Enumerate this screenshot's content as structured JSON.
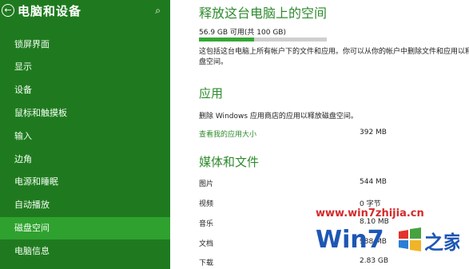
{
  "sidebar": {
    "title": "电脑和设备",
    "back_icon": "back-arrow-icon",
    "search_icon": "search-icon",
    "selected_color": "#2fa12f",
    "bg_color": "#1f7a1f",
    "items": [
      {
        "label": "锁屏界面"
      },
      {
        "label": "显示"
      },
      {
        "label": "设备"
      },
      {
        "label": "鼠标和触摸板"
      },
      {
        "label": "输入"
      },
      {
        "label": "边角"
      },
      {
        "label": "电源和睡眠"
      },
      {
        "label": "自动播放"
      },
      {
        "label": "磁盘空间"
      },
      {
        "label": "电脑信息"
      }
    ],
    "selected_index": 8
  },
  "main": {
    "title": "释放这台电脑上的空间",
    "storage_text": "56.9 GB 可用(共 100 GB)",
    "storage_used_fraction": 0.43,
    "description": "这包括这台电脑上所有帐户下的文件和应用。你可以从你的帐户中删除文件和应用以释放磁",
    "description2": "盘空间。",
    "apps": {
      "heading": "应用",
      "desc": "删除 Windows 应用商店的应用以释放磁盘空间。",
      "link": "查看我的应用大小",
      "size": "392 MB"
    },
    "media": {
      "heading": "媒体和文件",
      "rows": [
        {
          "label": "图片",
          "size": "544 MB"
        },
        {
          "label": "视频",
          "size": "0 字节"
        },
        {
          "label": "音乐",
          "size": "8.10 MB"
        },
        {
          "label": "文档",
          "size": "988 MB"
        },
        {
          "label": "下载",
          "size": "2.83 GB"
        }
      ]
    }
  },
  "watermark": {
    "url": "www.win7zhijia.cn",
    "logo_text": "Win7",
    "logo_suffix": "之家"
  }
}
